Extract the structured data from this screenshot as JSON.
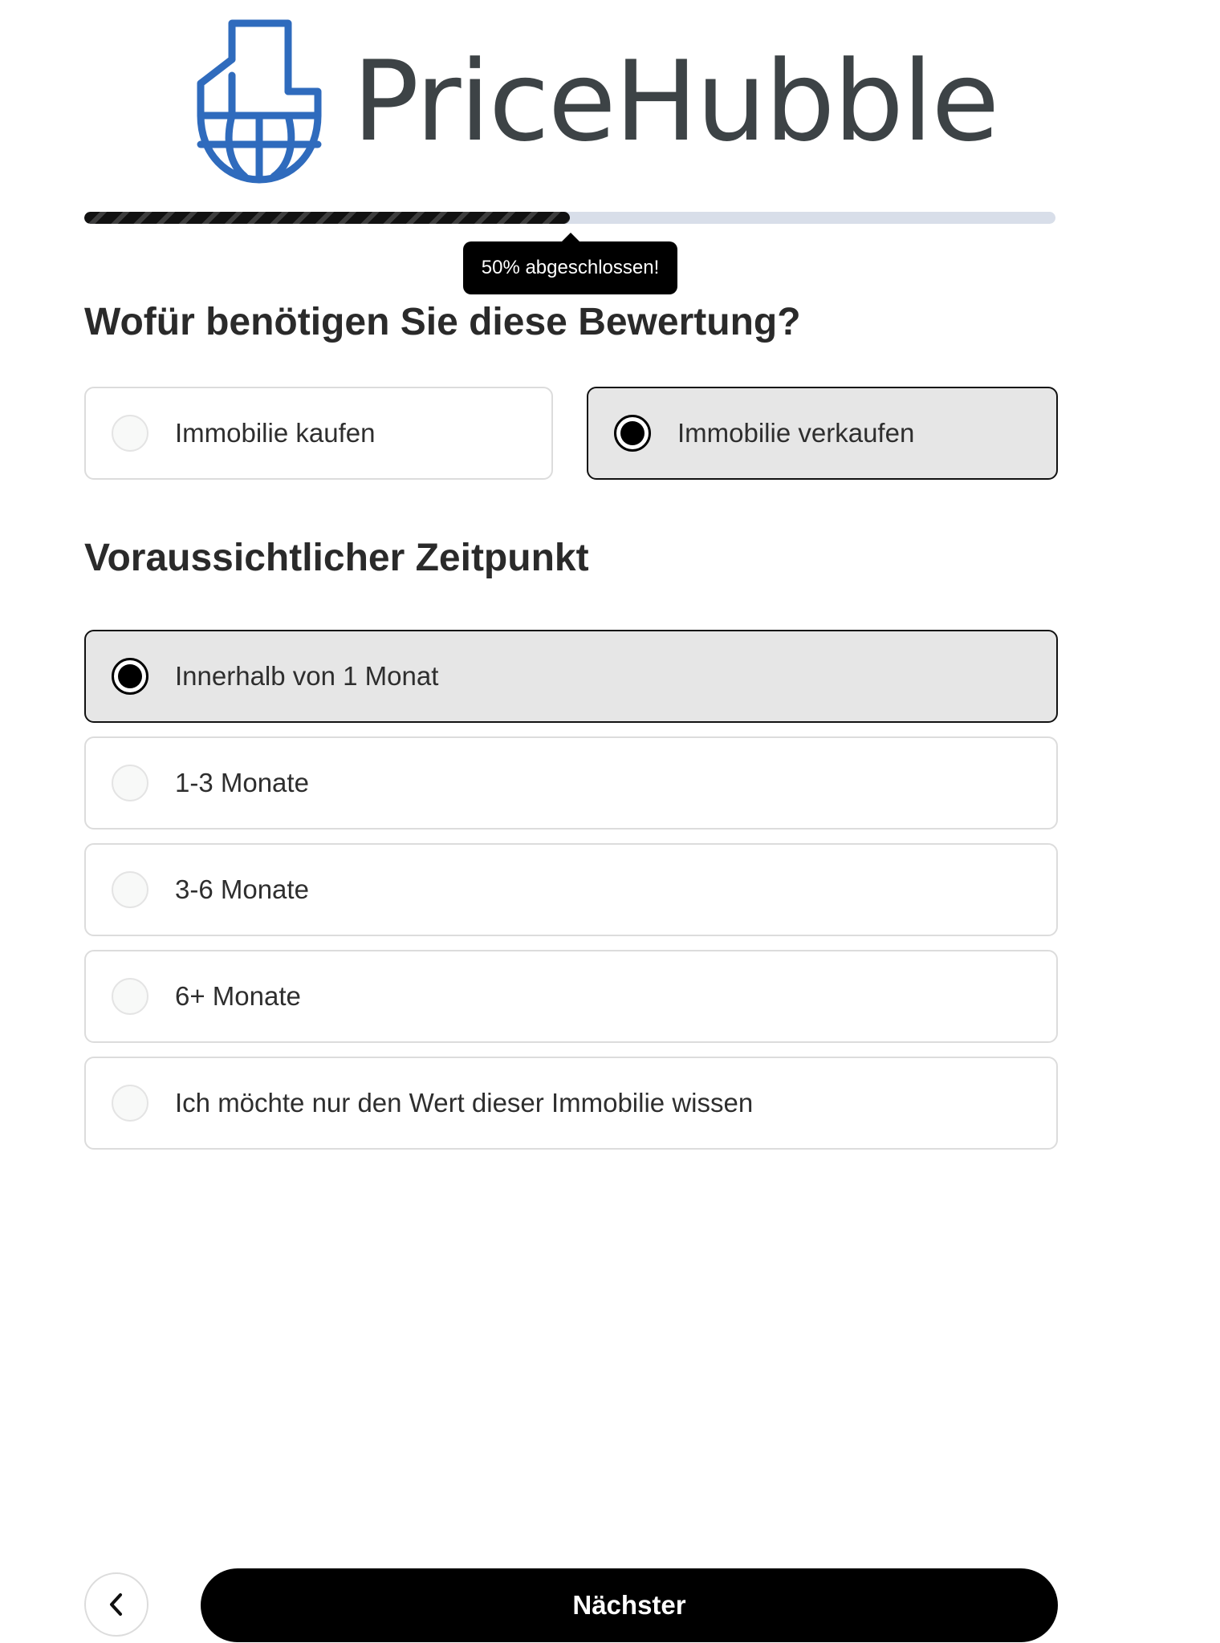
{
  "logo": {
    "text": "PriceHubble",
    "icon": "building-globe-icon",
    "color": "#2f6bbd"
  },
  "progress": {
    "percent": 50,
    "label": "50% abgeschlossen!"
  },
  "purpose": {
    "heading": "Wofür benötigen Sie diese Bewertung?",
    "options": [
      {
        "label": "Immobilie kaufen",
        "selected": false
      },
      {
        "label": "Immobilie verkaufen",
        "selected": true
      }
    ]
  },
  "timing": {
    "heading": "Voraussichtlicher Zeitpunkt",
    "options": [
      {
        "label": "Innerhalb von 1 Monat",
        "selected": true
      },
      {
        "label": "1-3 Monate",
        "selected": false
      },
      {
        "label": "3-6 Monate",
        "selected": false
      },
      {
        "label": "6+ Monate",
        "selected": false
      },
      {
        "label": "Ich möchte nur den Wert dieser Immobilie wissen",
        "selected": false
      }
    ]
  },
  "nav": {
    "back_icon": "chevron-left-icon",
    "next_label": "Nächster"
  }
}
